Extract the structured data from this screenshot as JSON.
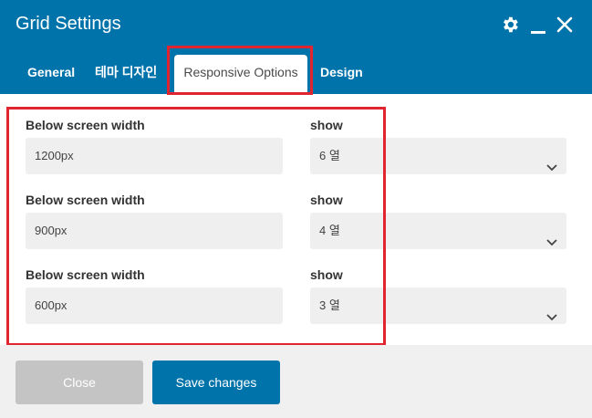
{
  "dialog": {
    "title": "Grid Settings"
  },
  "tabs": [
    {
      "label": "General"
    },
    {
      "label": "테마 디자인"
    },
    {
      "label": "Responsive Options"
    },
    {
      "label": "Design"
    }
  ],
  "rows": [
    {
      "width_label": "Below screen width",
      "width_value": "1200px",
      "show_label": "show",
      "show_value": "6 열"
    },
    {
      "width_label": "Below screen width",
      "width_value": "900px",
      "show_label": "show",
      "show_value": "4 열"
    },
    {
      "width_label": "Below screen width",
      "width_value": "600px",
      "show_label": "show",
      "show_value": "3 열"
    }
  ],
  "footer": {
    "close_label": "Close",
    "save_label": "Save changes"
  },
  "colors": {
    "header": "#0073aa",
    "highlight": "#e02530",
    "field_bg": "#efefef",
    "close_button": "#c4c4c4"
  },
  "icons": [
    "gear-icon",
    "minimize-icon",
    "close-icon",
    "chevron-down-icon"
  ]
}
